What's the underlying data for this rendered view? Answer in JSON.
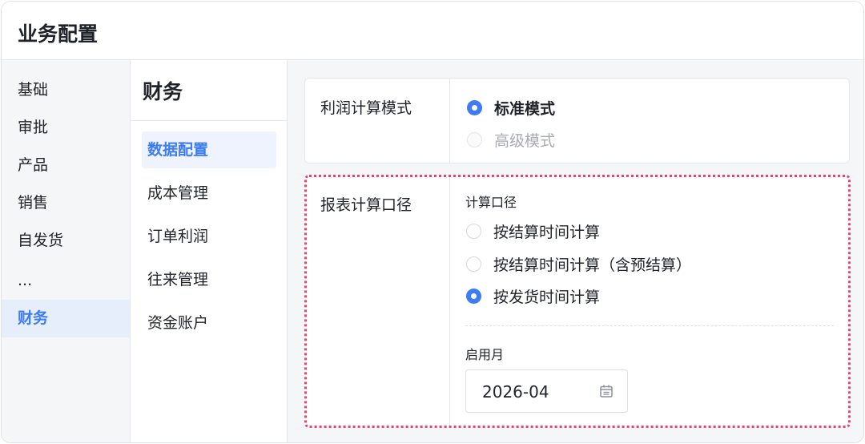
{
  "header": {
    "title": "业务配置"
  },
  "nav_primary": {
    "items": [
      {
        "label": "基础"
      },
      {
        "label": "审批"
      },
      {
        "label": "产品"
      },
      {
        "label": "销售"
      },
      {
        "label": "自发货"
      },
      {
        "label": "..."
      },
      {
        "label": "财务",
        "active": true
      }
    ]
  },
  "nav_secondary": {
    "title": "财务",
    "items": [
      {
        "label": "数据配置",
        "active": true
      },
      {
        "label": "成本管理"
      },
      {
        "label": "订单利润"
      },
      {
        "label": "往来管理"
      },
      {
        "label": "资金账户"
      }
    ]
  },
  "profit_mode": {
    "label": "利润计算模式",
    "options": [
      {
        "label": "标准模式",
        "checked": true
      },
      {
        "label": "高级模式",
        "disabled": true
      }
    ]
  },
  "report_basis": {
    "label": "报表计算口径",
    "field_label": "计算口径",
    "options": [
      {
        "label": "按结算时间计算",
        "checked": false
      },
      {
        "label": "按结算时间计算（含预结算）",
        "checked": false
      },
      {
        "label": "按发货时间计算",
        "checked": true
      }
    ],
    "enable_month_label": "启用月",
    "enable_month_value": "2026-04",
    "calendar_icon": "calendar-icon"
  },
  "colors": {
    "accent": "#3d7cf2",
    "highlight_border": "#e8436d",
    "panel_bg": "#f5f6f8"
  }
}
